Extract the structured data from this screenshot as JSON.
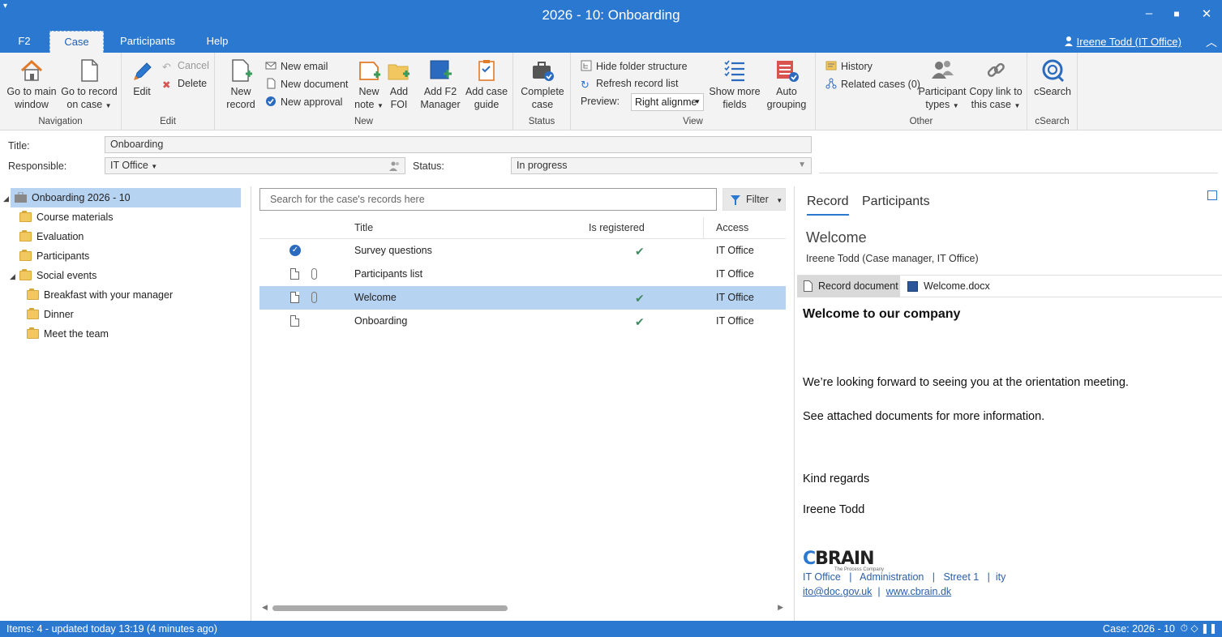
{
  "window": {
    "title": "2026 - 10: Onboarding",
    "sysmenu_icon": "chevron-down",
    "minimize": "▬",
    "maximize": "■",
    "close": "✕"
  },
  "tabs": [
    "F2",
    "Case",
    "Participants",
    "Help"
  ],
  "active_tab": "Case",
  "user": {
    "name": "Ireene Todd (IT Office)"
  },
  "ribbon": {
    "navigation": {
      "label": "Navigation",
      "go_main_1": "Go to main",
      "go_main_2": "window",
      "go_record_1": "Go to record",
      "go_record_2": "on case"
    },
    "edit": {
      "label": "Edit",
      "edit": "Edit",
      "cancel": "Cancel",
      "delete": "Delete"
    },
    "new": {
      "label": "New",
      "new_record_1": "New",
      "new_record_2": "record",
      "new_email": "New email",
      "new_document": "New document",
      "new_approval": "New approval",
      "new_note_1": "New",
      "new_note_2": "note",
      "add_foi_1": "Add",
      "add_foi_2": "FOI",
      "add_f2_1": "Add F2",
      "add_f2_2": "Manager",
      "add_guide_1": "Add case",
      "add_guide_2": "guide"
    },
    "status": {
      "label": "Status",
      "complete_1": "Complete",
      "complete_2": "case"
    },
    "view": {
      "label": "View",
      "hide_folder": "Hide folder structure",
      "refresh": "Refresh record list",
      "preview_label": "Preview:",
      "preview_value": "Right alignme",
      "show_more_1": "Show more",
      "show_more_2": "fields",
      "auto_1": "Auto",
      "auto_2": "grouping"
    },
    "other": {
      "label": "Other",
      "history": "History",
      "related": "Related cases (0)",
      "ptypes_1": "Participant",
      "ptypes_2": "types",
      "copylink_1": "Copy link to",
      "copylink_2": "this case"
    },
    "csearch": {
      "label": "cSearch",
      "btn": "cSearch"
    }
  },
  "fields": {
    "title_label": "Title:",
    "title_value": "Onboarding",
    "responsible_label": "Responsible:",
    "responsible_value": "IT Office",
    "status_label": "Status:",
    "status_value": "In progress"
  },
  "tree": {
    "root": "Onboarding 2026 - 10",
    "items": [
      {
        "label": "Course materials"
      },
      {
        "label": "Evaluation"
      },
      {
        "label": "Participants"
      },
      {
        "label": "Social events"
      },
      {
        "label": "Breakfast with your manager"
      },
      {
        "label": "Dinner"
      },
      {
        "label": "Meet the team"
      }
    ]
  },
  "records": {
    "search_placeholder": "Search for the case's records here",
    "filter_label": "Filter",
    "columns": {
      "title": "Title",
      "registered": "Is registered",
      "access": "Access"
    },
    "rows": [
      {
        "title": "Survey questions",
        "registered": true,
        "access": "IT Office",
        "type": "approval",
        "attachment": false
      },
      {
        "title": "Participants list",
        "registered": false,
        "access": "IT Office",
        "type": "document",
        "attachment": true
      },
      {
        "title": "Welcome",
        "registered": true,
        "access": "IT Office",
        "type": "document",
        "attachment": true,
        "selected": true
      },
      {
        "title": "Onboarding",
        "registered": true,
        "access": "IT Office",
        "type": "document",
        "attachment": false
      }
    ]
  },
  "preview": {
    "tabs": [
      "Record",
      "Participants"
    ],
    "title": "Welcome",
    "subtitle": "Ireene Todd (Case manager, IT Office)",
    "doc_tabs": [
      "Record document",
      "Welcome.docx"
    ],
    "heading": "Welcome to our company",
    "para1": "We’re looking forward to seeing you at the orientation meeting.",
    "para2": "See attached documents for more information.",
    "closing": "Kind regards",
    "signature": "Ireene Todd",
    "logo_c": "C",
    "logo_rest": "BRAIN",
    "logo_tagline": "The Process Company",
    "footer_line1": "IT Office   |   Administration   |   Street 1   |  ity",
    "email": "ito@doc.gov.uk",
    "sep": "|",
    "website": "www.cbrain.dk"
  },
  "statusbar": {
    "left": "Items: 4 - updated today 13:19 (4 minutes ago)",
    "right": "Case: 2026 - 10"
  },
  "colors": {
    "accent": "#2b78d0",
    "selection": "#b7d3f2",
    "ribbon_bg": "#f3f3f3"
  }
}
